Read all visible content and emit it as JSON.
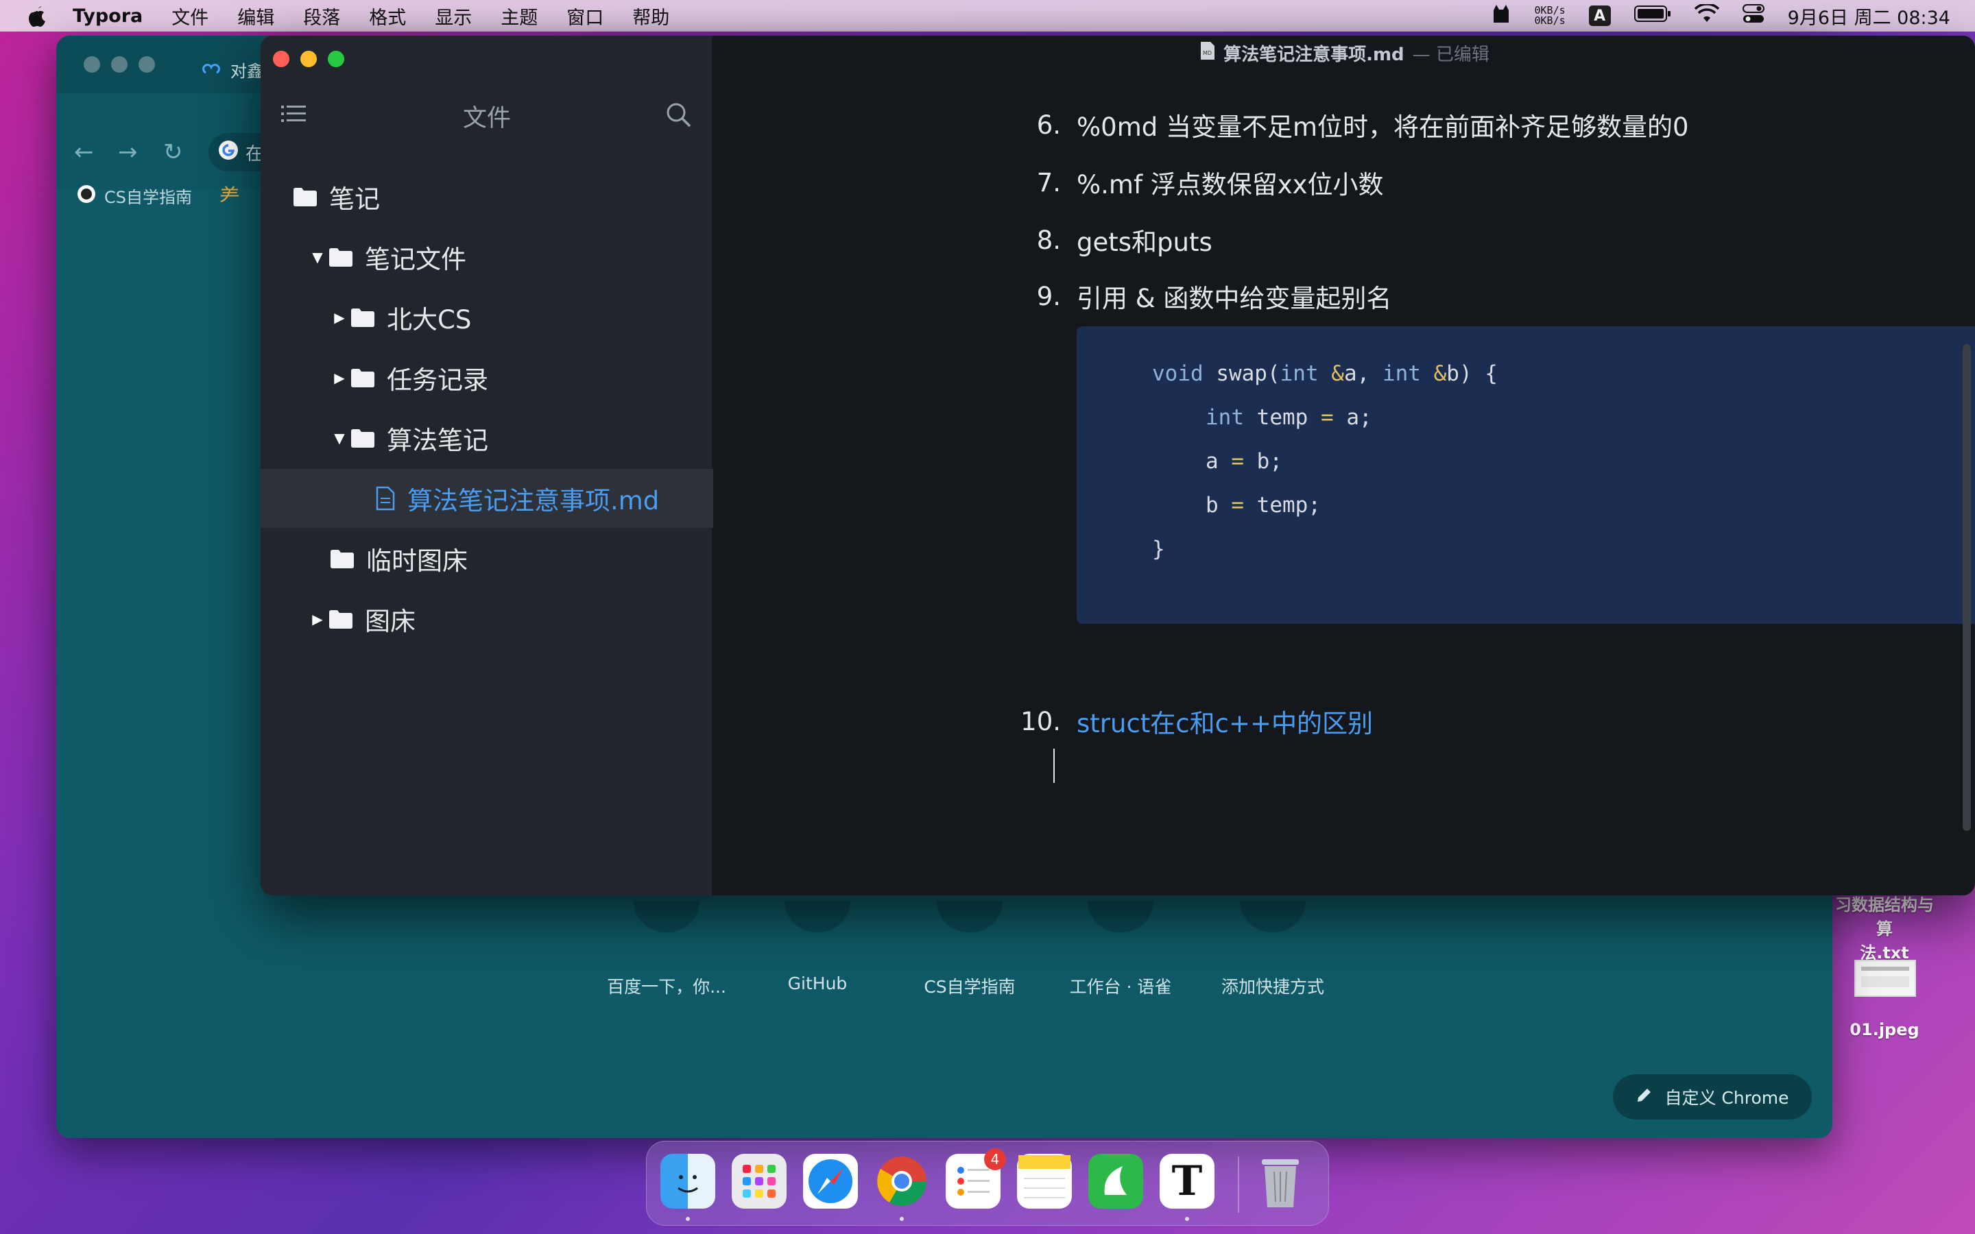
{
  "menubar": {
    "app_name": "Typora",
    "items": [
      "文件",
      "编辑",
      "段落",
      "格式",
      "显示",
      "主题",
      "窗口",
      "帮助"
    ],
    "net_up": "0KB/s",
    "net_down": "0KB/s",
    "input_method": "A",
    "datetime": "9月6日 周二  08:34"
  },
  "desktop": {
    "file1_label_line1": "习数据结构与算",
    "file1_label_line2": "法.txt",
    "file2_label": "01.jpeg"
  },
  "chrome": {
    "tab_title": "对鑫",
    "address_prefix": "在",
    "bookmark_1": "CS自学指南",
    "shortcuts": [
      "百度一下，你...",
      "GitHub",
      "CS自学指南",
      "工作台 · 语雀",
      "添加快捷方式"
    ],
    "customize_label": "自定义 Chrome"
  },
  "typora": {
    "sidebar_title": "文件",
    "tree": [
      {
        "label": "笔记",
        "type": "folder",
        "level": 0,
        "arrow": ""
      },
      {
        "label": "笔记文件",
        "type": "folder",
        "level": 1,
        "arrow": "down"
      },
      {
        "label": "北大CS",
        "type": "folder",
        "level": 2,
        "arrow": "right"
      },
      {
        "label": "任务记录",
        "type": "folder",
        "level": 2,
        "arrow": "right"
      },
      {
        "label": "算法笔记",
        "type": "folder",
        "level": 2,
        "arrow": "down"
      },
      {
        "label": "算法笔记注意事项.md",
        "type": "file",
        "level": 3,
        "arrow": "",
        "active": true
      },
      {
        "label": "临时图床",
        "type": "folder",
        "level": 1,
        "arrow": ""
      },
      {
        "label": "图床",
        "type": "folder",
        "level": 1,
        "arrow": "right"
      }
    ],
    "doc_title": "算法笔记注意事项.md",
    "doc_status": "— 已编辑",
    "list_items": [
      {
        "num": "6.",
        "text": "%0md  当变量不足m位时，将在前面补齐足够数量的0"
      },
      {
        "num": "7.",
        "text": "%.mf  浮点数保留xx位小数"
      },
      {
        "num": "8.",
        "text": "gets和puts"
      },
      {
        "num": "9.",
        "text": "引用 & 函数中给变量起别名"
      },
      {
        "num": "10.",
        "text": "struct在c和c++中的区别"
      }
    ],
    "code": {
      "line1_kw1": "void",
      "line1_rest_a": " swap(",
      "line1_kw2": "int",
      "line1_amp1": " &",
      "line1_a": "a, ",
      "line1_kw3": "int",
      "line1_amp2": " &",
      "line1_b": "b) {",
      "line2_kw": "int",
      "line2_var": " temp ",
      "line2_eq": "=",
      "line2_rest": " a;",
      "line3_var": "a ",
      "line3_eq": "=",
      "line3_rest": " b;",
      "line4_var": "b ",
      "line4_eq": "=",
      "line4_rest": " temp;",
      "line5": "}"
    }
  },
  "dock": {
    "reminders_badge": "4",
    "textedit_glyph": "T"
  }
}
